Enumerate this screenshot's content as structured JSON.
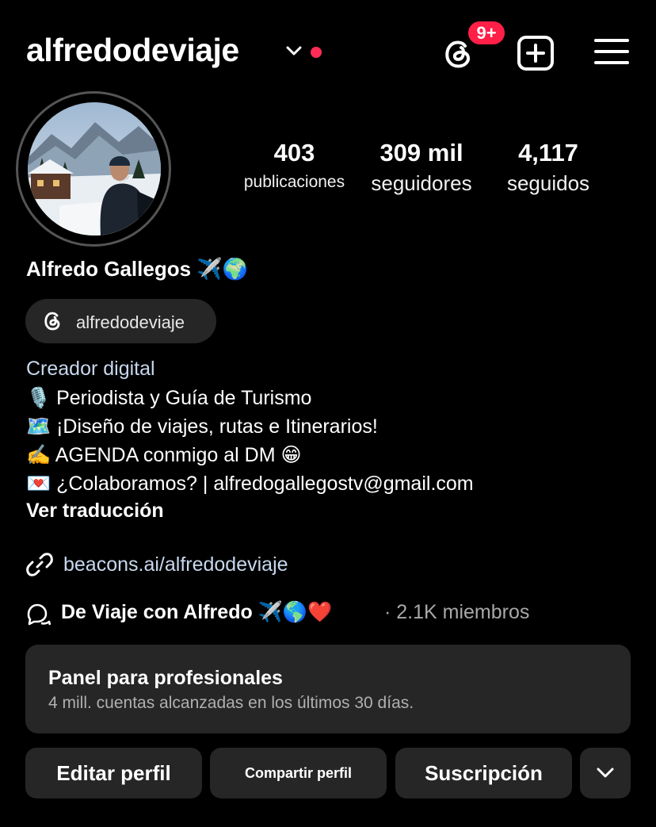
{
  "header": {
    "username": "alfredodeviaje",
    "notification_badge": "9+",
    "accent_color": "#ff1f47"
  },
  "icons": {
    "chevron": "chevron-down-icon",
    "threads": "threads-icon",
    "add": "plus-square-icon",
    "menu": "hamburger-menu-icon",
    "link": "link-icon",
    "channel": "broadcast-channel-icon",
    "more": "chevron-down-icon"
  },
  "stats": [
    {
      "value": "403",
      "label": "publicaciones"
    },
    {
      "value": "309 mil",
      "label": "seguidores"
    },
    {
      "value": "4,117",
      "label": "seguidos"
    }
  ],
  "profile": {
    "full_name": "Alfredo Gallegos ✈️🌍",
    "threads_handle": "alfredodeviaje",
    "category": "Creador digital",
    "bio_lines": [
      "🎙️ Periodista y Guía de Turismo",
      "🗺️ ¡Diseño de viajes, rutas e Itinerarios!",
      "✍️ AGENDA conmigo al DM 😁",
      "💌 ¿Colaboramos? | alfredogallegostv@gmail.com"
    ],
    "translate_label": "Ver traducción",
    "link": "beacons.ai/alfredodeviaje",
    "channel_name": "De Viaje con Alfredo ✈️🌎❤️",
    "channel_meta": "· 2.1K miembros"
  },
  "dashboard": {
    "title": "Panel para profesionales",
    "subtitle": "4 mill. cuentas alcanzadas en los últimos 30 días."
  },
  "actions": {
    "edit": "Editar perfil",
    "share": "Compartir perfil",
    "subscription": "Suscripción"
  }
}
